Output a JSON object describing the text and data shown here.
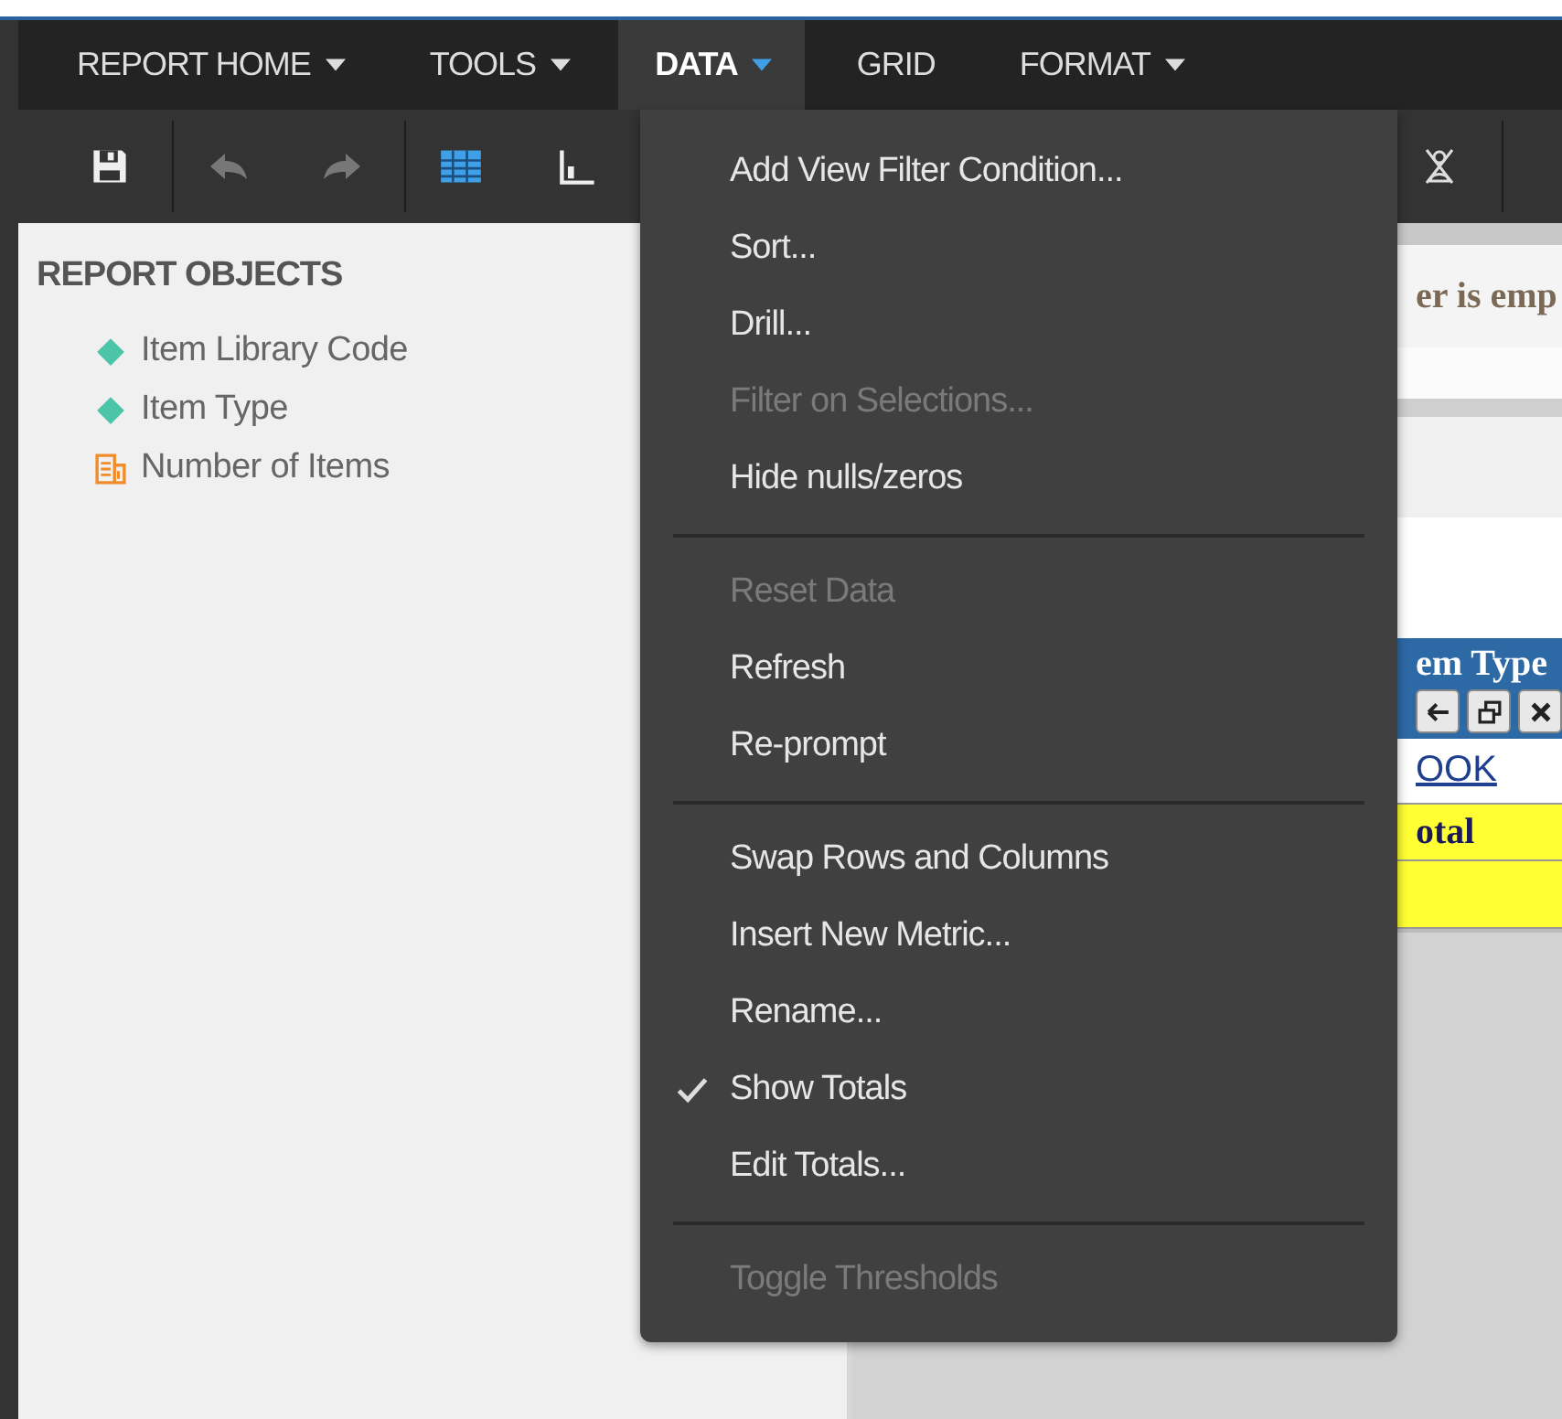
{
  "menu_bar": [
    {
      "label": "REPORT HOME",
      "caret": true,
      "selected": false
    },
    {
      "label": "TOOLS",
      "caret": true,
      "selected": false
    },
    {
      "label": "DATA",
      "caret": true,
      "selected": true
    },
    {
      "label": "GRID",
      "caret": false,
      "selected": false
    },
    {
      "label": "FORMAT",
      "caret": true,
      "selected": false
    }
  ],
  "report_objects": {
    "title": "REPORT OBJECTS",
    "items": [
      {
        "label": "Item Library Code",
        "kind": "attribute"
      },
      {
        "label": "Item Type",
        "kind": "attribute"
      },
      {
        "label": "Number of Items",
        "kind": "metric"
      }
    ]
  },
  "report_area": {
    "prompt_text": "er is emp",
    "grid": {
      "header": "em Type",
      "row_value": "OOK",
      "total_label": "otal"
    }
  },
  "data_menu": {
    "items": [
      {
        "kind": "item",
        "label": "Add View Filter Condition...",
        "disabled": false,
        "checked": false
      },
      {
        "kind": "item",
        "label": "Sort...",
        "disabled": false,
        "checked": false
      },
      {
        "kind": "item",
        "label": "Drill...",
        "disabled": false,
        "checked": false
      },
      {
        "kind": "item",
        "label": "Filter on Selections...",
        "disabled": true,
        "checked": false
      },
      {
        "kind": "item",
        "label": "Hide nulls/zeros",
        "disabled": false,
        "checked": false
      },
      {
        "kind": "separator"
      },
      {
        "kind": "item",
        "label": "Reset Data",
        "disabled": true,
        "checked": false
      },
      {
        "kind": "item",
        "label": "Refresh",
        "disabled": false,
        "checked": false
      },
      {
        "kind": "item",
        "label": "Re-prompt",
        "disabled": false,
        "checked": false
      },
      {
        "kind": "separator"
      },
      {
        "kind": "item",
        "label": "Swap Rows and Columns",
        "disabled": false,
        "checked": false
      },
      {
        "kind": "item",
        "label": "Insert New Metric...",
        "disabled": false,
        "checked": false
      },
      {
        "kind": "item",
        "label": "Rename...",
        "disabled": false,
        "checked": false
      },
      {
        "kind": "item",
        "label": "Show Totals",
        "disabled": false,
        "checked": true
      },
      {
        "kind": "item",
        "label": "Edit Totals...",
        "disabled": false,
        "checked": false
      },
      {
        "kind": "separator"
      },
      {
        "kind": "item",
        "label": "Toggle Thresholds",
        "disabled": true,
        "checked": false
      }
    ]
  }
}
